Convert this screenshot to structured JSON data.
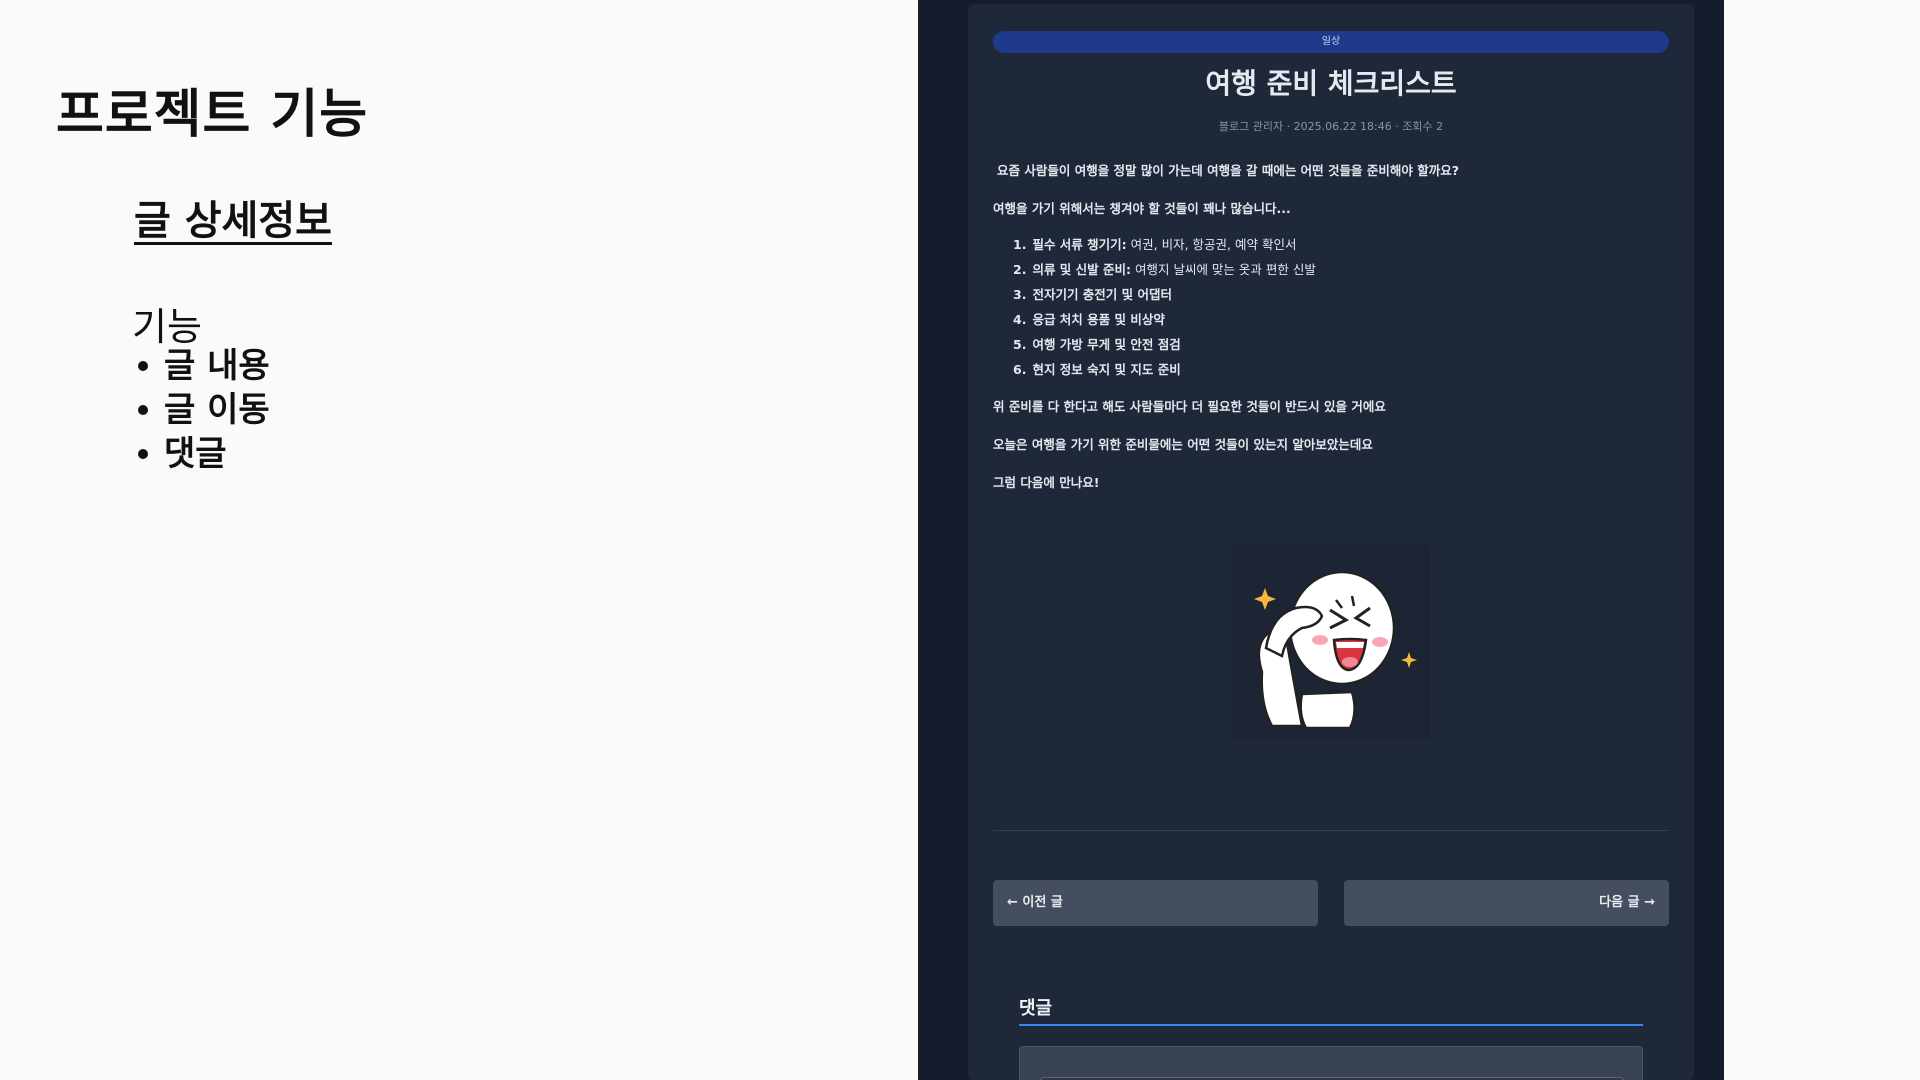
{
  "slide": {
    "title": "프로젝트 기능",
    "subtitle": "글 상세정보",
    "feature_heading": "기능",
    "features": [
      "글 내용",
      "글 이동",
      "댓글"
    ]
  },
  "post": {
    "category": "일상",
    "title": "여행 준비 체크리스트",
    "meta": "블로그 관리자 · 2025.06.22 18:46 · 조회수 2",
    "intro": "요즘 사람들이 여행을 정말 많이 가는데 여행을 갈 때에는 어떤 것들을 준비해야 할까요?",
    "lead": "여행을 가기 위해서는 챙겨야 할 것들이 꽤나 많습니다...",
    "checklist": [
      {
        "num": "1.",
        "strong": "필수 서류 챙기기:",
        "rest": " 여권, 비자, 항공권, 예약 확인서"
      },
      {
        "num": "2.",
        "strong": "의류 및 신발 준비:",
        "rest": " 여행지 날씨에 맞는 옷과 편한 신발"
      },
      {
        "num": "3.",
        "strong": "전자기기 충전기 및 어댑터",
        "rest": ""
      },
      {
        "num": "4.",
        "strong": "응급 처치 용품 및 비상약",
        "rest": ""
      },
      {
        "num": "5.",
        "strong": "여행 가방 무게 및 안전 점검",
        "rest": ""
      },
      {
        "num": "6.",
        "strong": "현지 정보 숙지 및 지도 준비",
        "rest": ""
      }
    ],
    "para1": "위 준비를 다 한다고 해도 사람들마다 더 필요한 것들이 반드시 있을 거에요",
    "para2": "오늘은 여행을 가기 위한 준비물에는 어떤 것들이 있는지 알아보았는데요",
    "para3": "그럼 다음에 만나요!"
  },
  "navigation": {
    "prev_label": "← 이전 글",
    "next_label": "다음 글 →"
  },
  "comments": {
    "title": "댓글"
  },
  "colors": {
    "accent": "#3b82f6",
    "category_bar": "#1f3a8a",
    "card_bg": "#1f2838",
    "screen_bg": "#151c2b"
  }
}
